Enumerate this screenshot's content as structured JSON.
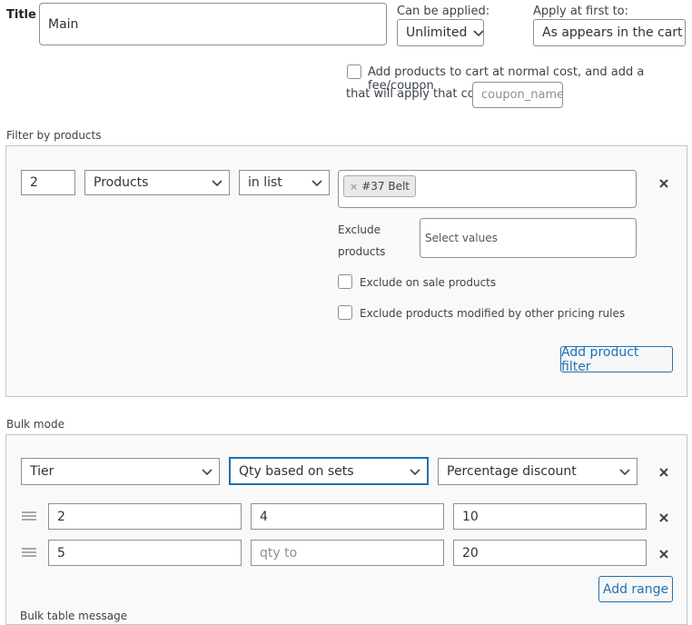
{
  "rule": {
    "title_label": "Title",
    "title_value": "Main",
    "can_be_applied_label": "Can be applied:",
    "can_be_applied_value": "Unlimited",
    "apply_at_first_label": "Apply at first to:",
    "apply_at_first_value": "As appears in the cart",
    "normal_cost_text_1": "Add products to cart at normal cost, and add a fee/coupon",
    "normal_cost_text_2": "that will apply that cost",
    "coupon_placeholder": "coupon_name"
  },
  "filter": {
    "section_label": "Filter by products",
    "qty_value": "2",
    "type_value": "Products",
    "method_value": "in list",
    "selected_tags": [
      "#37 Belt"
    ],
    "exclude_label_1": "Exclude",
    "exclude_label_2": "products",
    "exclude_placeholder": "Select values",
    "exclude_on_sale_label": "Exclude on sale products",
    "exclude_modified_label": "Exclude products modified by other pricing rules",
    "add_filter_label": "Add product filter"
  },
  "bulk": {
    "section_label": "Bulk mode",
    "type_value": "Tier",
    "qty_based_value": "Qty based on sets",
    "discount_value": "Percentage discount",
    "ranges": [
      {
        "from": "2",
        "to": "4",
        "value": "10",
        "to_is_placeholder": false
      },
      {
        "from": "5",
        "to": "qty to",
        "value": "20",
        "to_is_placeholder": true
      }
    ],
    "add_range_label": "Add range",
    "table_message_label": "Bulk table message"
  },
  "colors": {
    "accent": "#2271b1",
    "border": "#8c8f94",
    "panel_bg": "#f9f9f9"
  }
}
